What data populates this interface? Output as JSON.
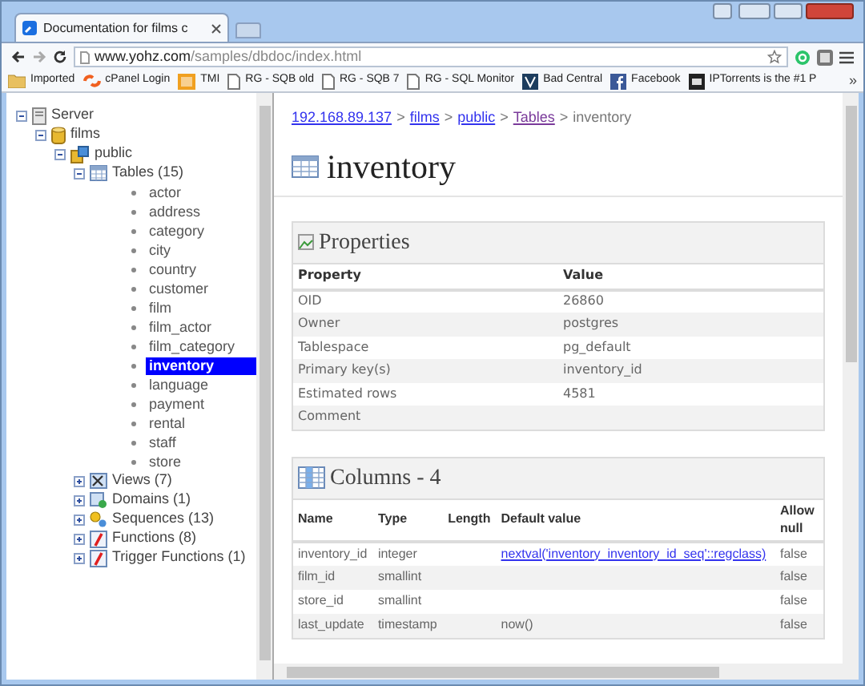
{
  "browser": {
    "tab_title": "Documentation for films c",
    "url_host": "www.yohz.com",
    "url_path": "/samples/dbdoc/index.html",
    "bookmarks": [
      {
        "label": "Imported",
        "kind": "folder"
      },
      {
        "label": "cPanel Login",
        "kind": "cpanel"
      },
      {
        "label": "TMI",
        "kind": "tmi"
      },
      {
        "label": "RG - SQB old",
        "kind": "page"
      },
      {
        "label": "RG - SQB 7",
        "kind": "page"
      },
      {
        "label": "RG - SQL Monitor",
        "kind": "page"
      },
      {
        "label": "Bad Central",
        "kind": "badge"
      },
      {
        "label": "Facebook",
        "kind": "facebook"
      },
      {
        "label": "IPTorrents is the #1 P",
        "kind": "ipt"
      }
    ],
    "more": "»"
  },
  "tree": [
    {
      "label": "Server",
      "kind": "server",
      "expanded": true,
      "selected": false,
      "children": [
        {
          "label": "films",
          "kind": "database",
          "expanded": true,
          "selected": false,
          "children": [
            {
              "label": "public",
              "kind": "schema",
              "expanded": true,
              "selected": false,
              "children": [
                {
                  "label": "Tables (15)",
                  "kind": "tables",
                  "expanded": true,
                  "selected": false,
                  "children": [
                    {
                      "label": "actor",
                      "kind": "leaf",
                      "selected": false
                    },
                    {
                      "label": "address",
                      "kind": "leaf",
                      "selected": false
                    },
                    {
                      "label": "category",
                      "kind": "leaf",
                      "selected": false
                    },
                    {
                      "label": "city",
                      "kind": "leaf",
                      "selected": false
                    },
                    {
                      "label": "country",
                      "kind": "leaf",
                      "selected": false
                    },
                    {
                      "label": "customer",
                      "kind": "leaf",
                      "selected": false
                    },
                    {
                      "label": "film",
                      "kind": "leaf",
                      "selected": false
                    },
                    {
                      "label": "film_actor",
                      "kind": "leaf",
                      "selected": false
                    },
                    {
                      "label": "film_category",
                      "kind": "leaf",
                      "selected": false
                    },
                    {
                      "label": "inventory",
                      "kind": "leaf",
                      "selected": true
                    },
                    {
                      "label": "language",
                      "kind": "leaf",
                      "selected": false
                    },
                    {
                      "label": "payment",
                      "kind": "leaf",
                      "selected": false
                    },
                    {
                      "label": "rental",
                      "kind": "leaf",
                      "selected": false
                    },
                    {
                      "label": "staff",
                      "kind": "leaf",
                      "selected": false
                    },
                    {
                      "label": "store",
                      "kind": "leaf",
                      "selected": false
                    }
                  ]
                },
                {
                  "label": "Views (7)",
                  "kind": "views",
                  "expanded": false,
                  "selected": false
                },
                {
                  "label": "Domains (1)",
                  "kind": "domains",
                  "expanded": false,
                  "selected": false
                },
                {
                  "label": "Sequences (13)",
                  "kind": "sequences",
                  "expanded": false,
                  "selected": false
                },
                {
                  "label": "Functions (8)",
                  "kind": "functions",
                  "expanded": false,
                  "selected": false
                },
                {
                  "label": "Trigger Functions (1)",
                  "kind": "functions",
                  "expanded": false,
                  "selected": false
                }
              ]
            }
          ]
        }
      ]
    }
  ],
  "breadcrumb": [
    {
      "label": "192.168.89.137",
      "kind": "link"
    },
    {
      "label": "films",
      "kind": "link"
    },
    {
      "label": "public",
      "kind": "link"
    },
    {
      "label": "Tables",
      "kind": "visited"
    },
    {
      "label": "inventory",
      "kind": "text"
    }
  ],
  "separator": ">",
  "page_title": "inventory",
  "properties": {
    "title": "Properties",
    "headers": [
      "Property",
      "Value"
    ],
    "rows": [
      [
        "OID",
        "26860"
      ],
      [
        "Owner",
        "postgres"
      ],
      [
        "Tablespace",
        "pg_default"
      ],
      [
        "Primary key(s)",
        "inventory_id"
      ],
      [
        "Estimated rows",
        "4581"
      ],
      [
        "Comment",
        ""
      ]
    ]
  },
  "columns": {
    "title": "Columns - 4",
    "headers": [
      "Name",
      "Type",
      "Length",
      "Default value",
      "Allow null"
    ],
    "rows": [
      {
        "name": "inventory_id",
        "type": "integer",
        "length": "",
        "default": "nextval('inventory_inventory_id_seq'::regclass)",
        "default_linked": true,
        "allow_null": "false"
      },
      {
        "name": "film_id",
        "type": "smallint",
        "length": "",
        "default": "",
        "allow_null": "false"
      },
      {
        "name": "store_id",
        "type": "smallint",
        "length": "",
        "default": "",
        "allow_null": "false"
      },
      {
        "name": "last_update",
        "type": "timestamp",
        "length": "",
        "default": "now()",
        "default_linked": false,
        "allow_null": "false"
      }
    ]
  }
}
